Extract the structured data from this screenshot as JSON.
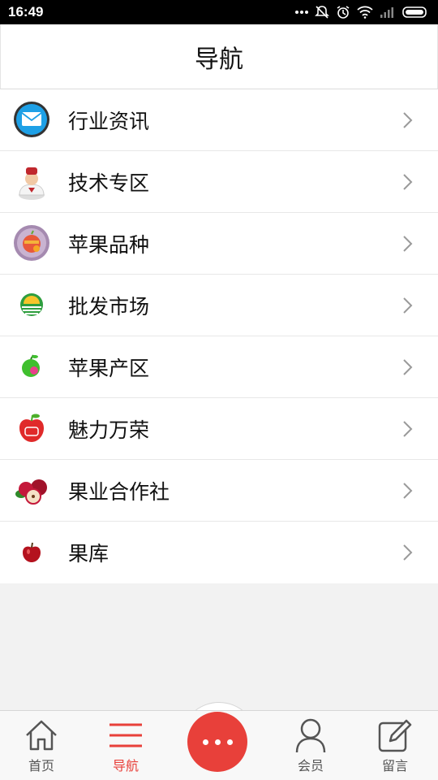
{
  "status_bar": {
    "time": "16:49"
  },
  "header": {
    "title": "导航"
  },
  "nav_items": [
    {
      "label": "行业资讯",
      "icon": "mail-icon"
    },
    {
      "label": "技术专区",
      "icon": "chef-icon"
    },
    {
      "label": "苹果品种",
      "icon": "apple-variety-icon"
    },
    {
      "label": "批发市场",
      "icon": "market-icon"
    },
    {
      "label": "苹果产区",
      "icon": "green-apple-icon"
    },
    {
      "label": "魅力万荣",
      "icon": "red-apple-icon"
    },
    {
      "label": "果业合作社",
      "icon": "apple-cluster-icon"
    },
    {
      "label": "果库",
      "icon": "small-apple-icon"
    }
  ],
  "tab_bar": {
    "home": "首页",
    "nav": "导航",
    "member": "会员",
    "message": "留言"
  },
  "colors": {
    "accent": "#e8403a"
  }
}
